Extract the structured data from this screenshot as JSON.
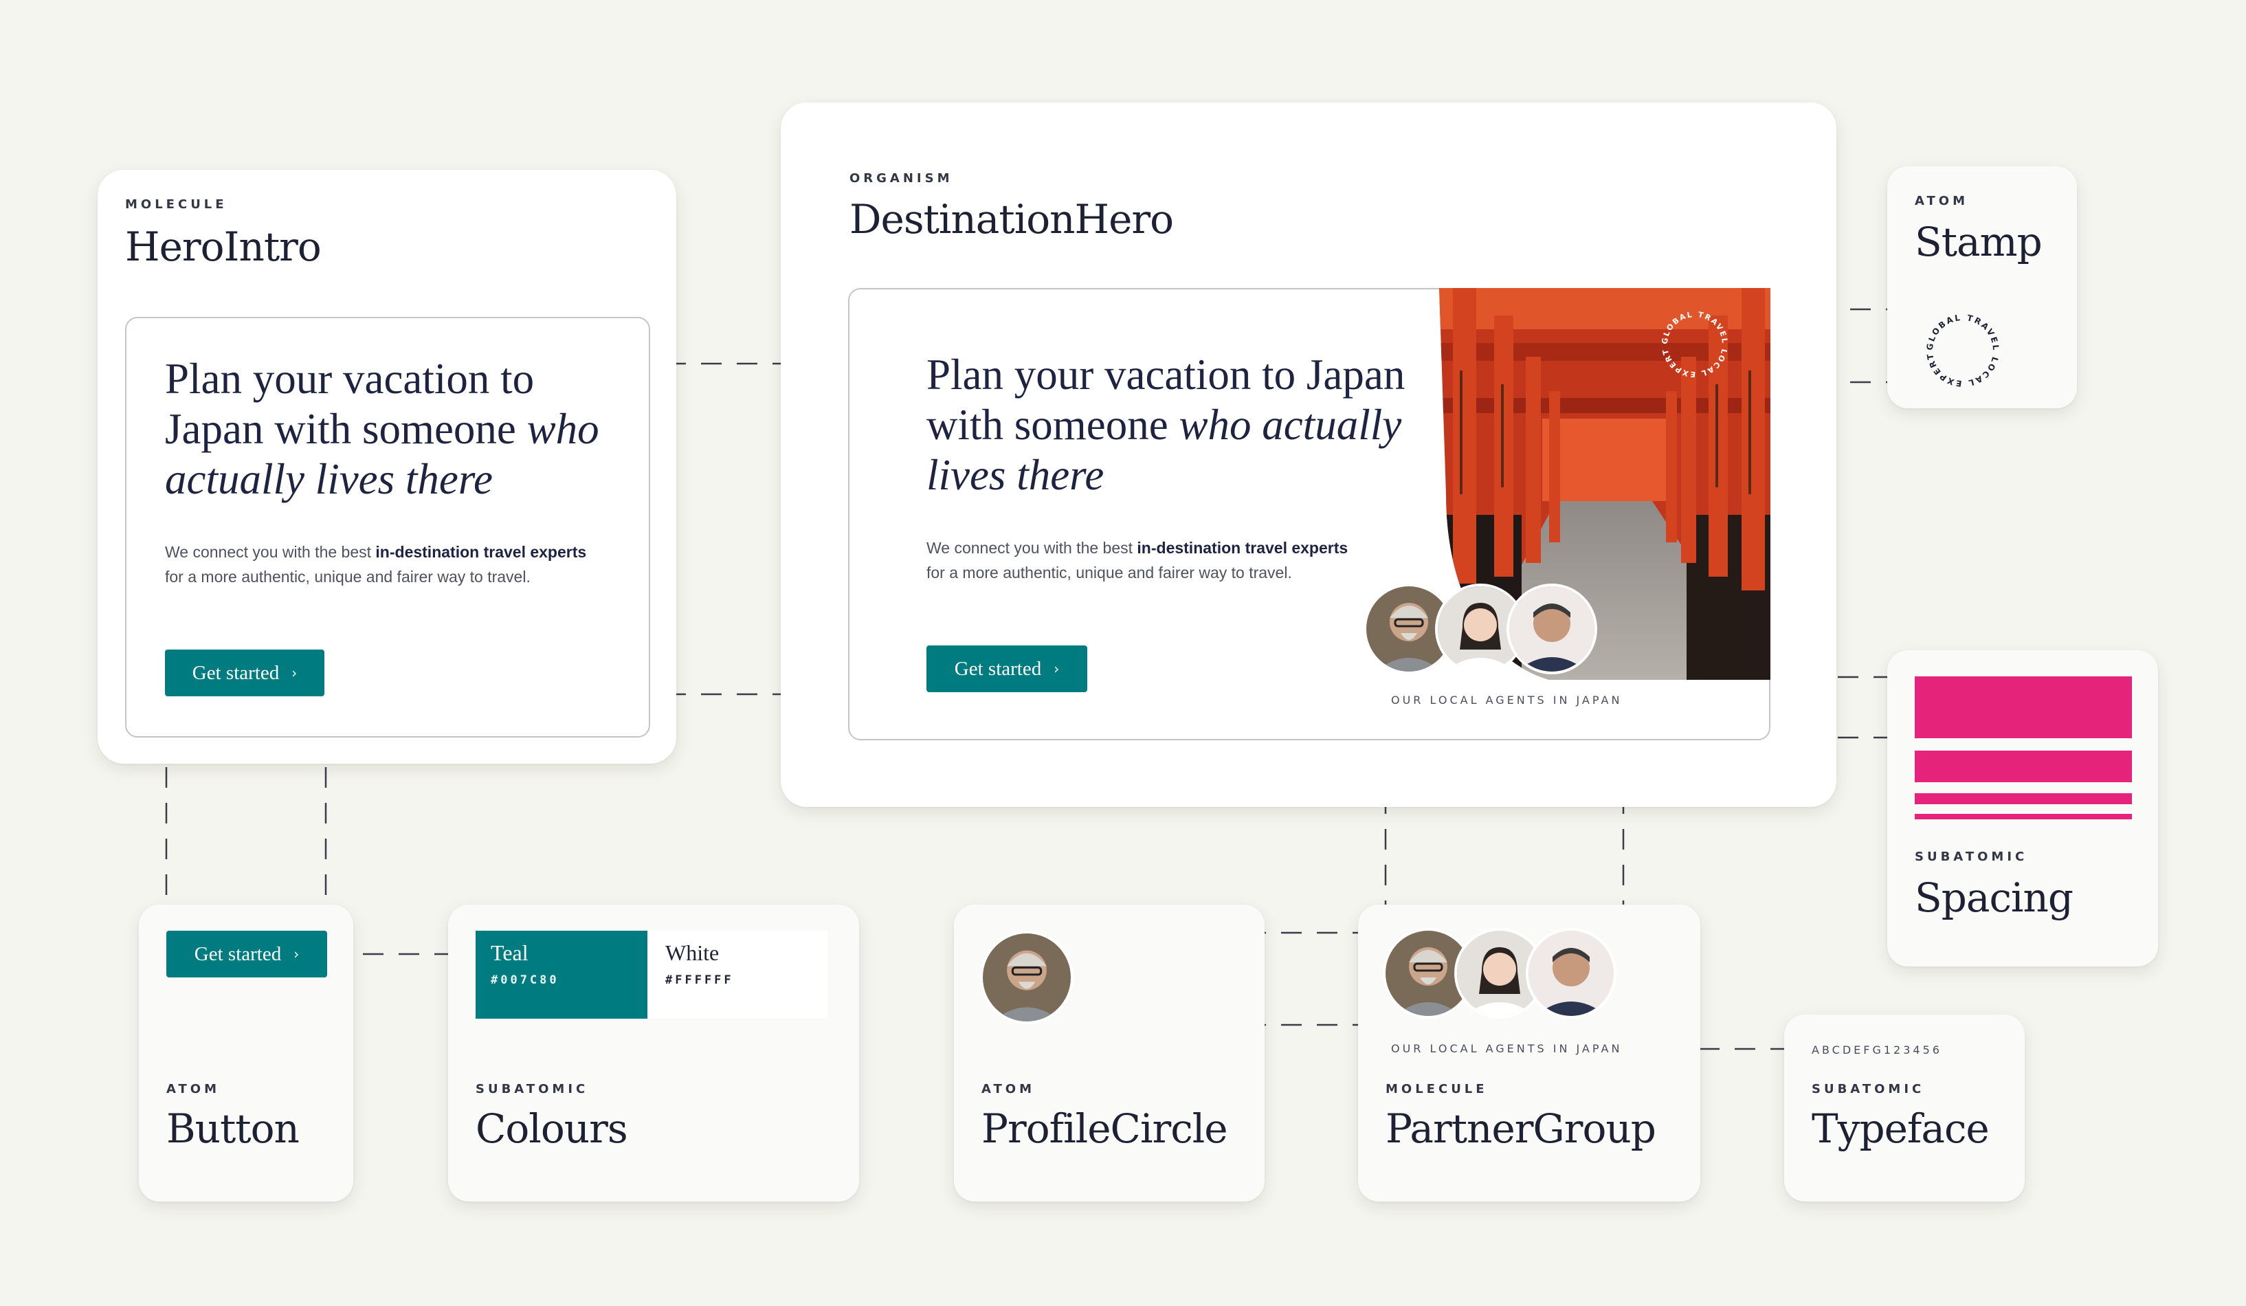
{
  "colors": {
    "teal": "#007C80",
    "white": "#FFFFFF",
    "spacing_pink": "#E5237A",
    "torii_red": "#D8401F"
  },
  "hero_intro": {
    "tag": "MOLECULE",
    "title": "HeroIntro"
  },
  "destination_hero": {
    "tag": "ORGANISM",
    "title": "DestinationHero",
    "image": "torii-gates-photo"
  },
  "content": {
    "headline_start": "Plan your vacation to Japan with someone ",
    "headline_emphasis": "who actually lives there",
    "body_start": "We connect you with the best ",
    "body_bold": "in-destination travel experts",
    "body_end": " for a more authentic, unique and fairer way to travel.",
    "button_label": "Get started",
    "agents_caption": "OUR LOCAL AGENTS IN JAPAN",
    "stamp_text": "GLOBAL TRAVEL LOCAL EXPERTS"
  },
  "stamp": {
    "tag": "ATOM",
    "title": "Stamp"
  },
  "spacing": {
    "tag": "SUBATOMIC",
    "title": "Spacing"
  },
  "button_card": {
    "tag": "ATOM",
    "title": "Button"
  },
  "colours": {
    "tag": "SUBATOMIC",
    "title": "Colours",
    "swatches": [
      {
        "name": "Teal",
        "hex": "#007C80"
      },
      {
        "name": "White",
        "hex": "#FFFFFF"
      }
    ]
  },
  "profile_circle": {
    "tag": "ATOM",
    "title": "ProfileCircle"
  },
  "partner_group": {
    "tag": "MOLECULE",
    "title": "PartnerGroup"
  },
  "typeface": {
    "tag": "SUBATOMIC",
    "title": "Typeface",
    "sample": "ABCDEFG123456"
  },
  "icons": {
    "chevron": "chevron-right-icon",
    "avatar": "person-avatar"
  }
}
